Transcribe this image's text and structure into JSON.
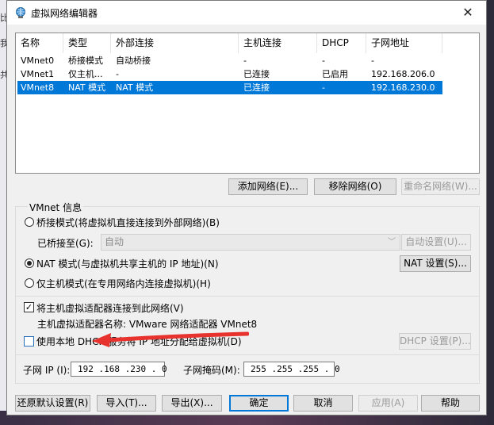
{
  "window": {
    "title": "虚拟网络编辑器",
    "close_glyph": "✕"
  },
  "background": {
    "edge_glyphs": [
      "比",
      "我",
      "共"
    ]
  },
  "table": {
    "headers": [
      "名称",
      "类型",
      "外部连接",
      "主机连接",
      "DHCP",
      "子网地址"
    ],
    "rows": [
      [
        "VMnet0",
        "桥接模式",
        "自动桥接",
        "-",
        "-",
        "-"
      ],
      [
        "VMnet1",
        "仅主机...",
        "-",
        "已连接",
        "已启用",
        "192.168.206.0"
      ],
      [
        "VMnet8",
        "NAT 模式",
        "NAT 模式",
        "已连接",
        "-",
        "192.168.230.0"
      ]
    ],
    "selected_index": 2,
    "selection_color": "#0078d7"
  },
  "net_buttons": {
    "add": "添加网络(E)...",
    "remove": "移除网络(O)",
    "rename": "重命名网络(W)..."
  },
  "vmnet_info": {
    "label": "VMnet 信息",
    "bridged_radio": "桥接模式(将虚拟机直接连接到外部网络)(B)",
    "bridged_to_label": "已桥接至(G):",
    "bridged_to_value": "自动",
    "auto_settings": "自动设置(U)...",
    "nat_radio": "NAT 模式(与虚拟机共享主机的 IP 地址)(N)",
    "nat_settings": "NAT 设置(S)...",
    "hostonly_radio": "仅主机模式(在专用网络内连接虚拟机)(H)",
    "selected_mode": "nat",
    "connect_adapter_check": "将主机虚拟适配器连接到此网络(V)",
    "connect_adapter_checked": true,
    "adapter_name_label": "主机虚拟适配器名称: VMware 网络适配器 VMnet8",
    "dhcp_check": "使用本地 DHCP 服务将 IP 地址分配给虚拟机(D)",
    "dhcp_checked": false,
    "dhcp_settings": "DHCP 设置(P)...",
    "subnet_ip_label": "子网 IP (I):",
    "subnet_ip_value": "192 .168 .230 . 0",
    "subnet_mask_label": "子网掩码(M):",
    "subnet_mask_value": "255 .255 .255 . 0"
  },
  "footer_buttons": {
    "restore": "还原默认设置(R)",
    "import": "导入(T)...",
    "export": "导出(X)...",
    "ok": "确定",
    "cancel": "取消",
    "apply": "应用(A)",
    "help": "帮助"
  },
  "annotation": {
    "arrow_color": "#e8322d"
  }
}
